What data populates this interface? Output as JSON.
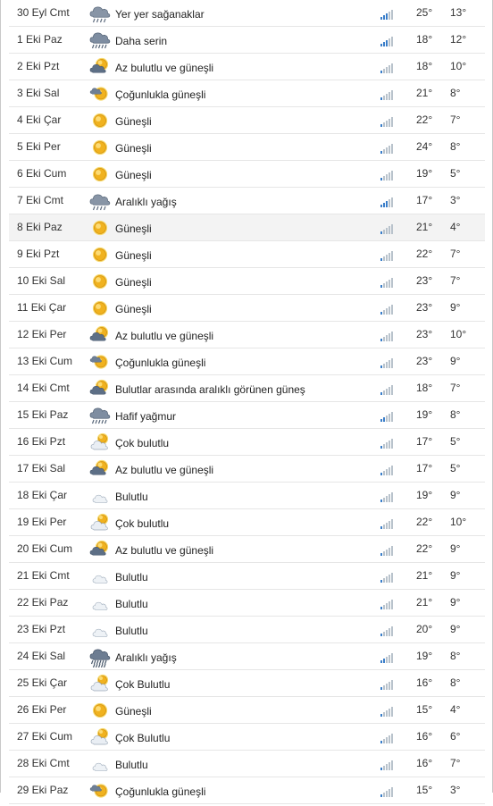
{
  "colors": {
    "row_border": "#e6e6e6",
    "highlight_row": "#f3f3f3",
    "signal_active": "#3a7ec9",
    "signal_inactive": "#b9c3cc"
  },
  "forecast": [
    {
      "day": "30 Eyl Cmt",
      "desc": "Yer yer sağanaklar",
      "icon": "showers-icon",
      "hi": "25°",
      "lo": "13°",
      "signal": 3,
      "highlight": false
    },
    {
      "day": "1 Eki Paz",
      "desc": "Daha serin",
      "icon": "rain-icon",
      "hi": "18°",
      "lo": "12°",
      "signal": 3,
      "highlight": false
    },
    {
      "day": "2 Eki Pzt",
      "desc": "Az bulutlu ve güneşli",
      "icon": "partly-sunny-icon",
      "hi": "18°",
      "lo": "10°",
      "signal": 1,
      "highlight": false
    },
    {
      "day": "3 Eki Sal",
      "desc": "Çoğunlukla güneşli",
      "icon": "mostly-sunny-icon",
      "hi": "21°",
      "lo": "8°",
      "signal": 1,
      "highlight": false
    },
    {
      "day": "4 Eki Çar",
      "desc": "Güneşli",
      "icon": "sun-icon",
      "hi": "22°",
      "lo": "7°",
      "signal": 1,
      "highlight": false
    },
    {
      "day": "5 Eki Per",
      "desc": "Güneşli",
      "icon": "sun-icon",
      "hi": "24°",
      "lo": "8°",
      "signal": 1,
      "highlight": false
    },
    {
      "day": "6 Eki Cum",
      "desc": "Güneşli",
      "icon": "sun-icon",
      "hi": "19°",
      "lo": "5°",
      "signal": 1,
      "highlight": false
    },
    {
      "day": "7 Eki Cmt",
      "desc": "Aralıklı yağış",
      "icon": "showers-icon",
      "hi": "17°",
      "lo": "3°",
      "signal": 3,
      "highlight": false
    },
    {
      "day": "8 Eki Paz",
      "desc": "Güneşli",
      "icon": "sun-icon",
      "hi": "21°",
      "lo": "4°",
      "signal": 1,
      "highlight": true
    },
    {
      "day": "9 Eki Pzt",
      "desc": "Güneşli",
      "icon": "sun-icon",
      "hi": "22°",
      "lo": "7°",
      "signal": 1,
      "highlight": false
    },
    {
      "day": "10 Eki Sal",
      "desc": "Güneşli",
      "icon": "sun-icon",
      "hi": "23°",
      "lo": "7°",
      "signal": 1,
      "highlight": false
    },
    {
      "day": "11 Eki Çar",
      "desc": "Güneşli",
      "icon": "sun-icon",
      "hi": "23°",
      "lo": "9°",
      "signal": 1,
      "highlight": false
    },
    {
      "day": "12 Eki Per",
      "desc": "Az bulutlu ve güneşli",
      "icon": "partly-sunny-icon",
      "hi": "23°",
      "lo": "10°",
      "signal": 1,
      "highlight": false
    },
    {
      "day": "13 Eki Cum",
      "desc": "Çoğunlukla güneşli",
      "icon": "mostly-sunny-icon",
      "hi": "23°",
      "lo": "9°",
      "signal": 1,
      "highlight": false
    },
    {
      "day": "14 Eki Cmt",
      "desc": "Bulutlar arasında aralıklı görünen güneş",
      "icon": "partly-sunny-icon",
      "hi": "18°",
      "lo": "7°",
      "signal": 1,
      "highlight": false
    },
    {
      "day": "15 Eki Paz",
      "desc": "Hafif yağmur",
      "icon": "rain-icon",
      "hi": "19°",
      "lo": "8°",
      "signal": 2,
      "highlight": false
    },
    {
      "day": "16 Eki Pzt",
      "desc": "Çok bulutlu",
      "icon": "mostly-cloudy-icon",
      "hi": "17°",
      "lo": "5°",
      "signal": 1,
      "highlight": false
    },
    {
      "day": "17 Eki Sal",
      "desc": "Az bulutlu ve güneşli",
      "icon": "partly-sunny-icon",
      "hi": "17°",
      "lo": "5°",
      "signal": 1,
      "highlight": false
    },
    {
      "day": "18 Eki Çar",
      "desc": "Bulutlu",
      "icon": "cloud-icon",
      "hi": "19°",
      "lo": "9°",
      "signal": 1,
      "highlight": false
    },
    {
      "day": "19 Eki Per",
      "desc": "Çok bulutlu",
      "icon": "mostly-cloudy-icon",
      "hi": "22°",
      "lo": "10°",
      "signal": 1,
      "highlight": false
    },
    {
      "day": "20 Eki Cum",
      "desc": "Az bulutlu ve güneşli",
      "icon": "partly-sunny-icon",
      "hi": "22°",
      "lo": "9°",
      "signal": 1,
      "highlight": false
    },
    {
      "day": "21 Eki Cmt",
      "desc": "Bulutlu",
      "icon": "cloud-icon",
      "hi": "21°",
      "lo": "9°",
      "signal": 1,
      "highlight": false
    },
    {
      "day": "22 Eki Paz",
      "desc": "Bulutlu",
      "icon": "cloud-icon",
      "hi": "21°",
      "lo": "9°",
      "signal": 1,
      "highlight": false
    },
    {
      "day": "23 Eki Pzt",
      "desc": "Bulutlu",
      "icon": "cloud-icon",
      "hi": "20°",
      "lo": "9°",
      "signal": 1,
      "highlight": false
    },
    {
      "day": "24 Eki Sal",
      "desc": "Aralıklı yağış",
      "icon": "heavy-rain-icon",
      "hi": "19°",
      "lo": "8°",
      "signal": 2,
      "highlight": false
    },
    {
      "day": "25 Eki Çar",
      "desc": "Çok Bulutlu",
      "icon": "mostly-cloudy-icon",
      "hi": "16°",
      "lo": "8°",
      "signal": 1,
      "highlight": false
    },
    {
      "day": "26 Eki Per",
      "desc": "Güneşli",
      "icon": "sun-icon",
      "hi": "15°",
      "lo": "4°",
      "signal": 1,
      "highlight": false
    },
    {
      "day": "27 Eki Cum",
      "desc": "Çok Bulutlu",
      "icon": "mostly-cloudy-icon",
      "hi": "16°",
      "lo": "6°",
      "signal": 1,
      "highlight": false
    },
    {
      "day": "28 Eki Cmt",
      "desc": "Bulutlu",
      "icon": "cloud-icon",
      "hi": "16°",
      "lo": "7°",
      "signal": 1,
      "highlight": false
    },
    {
      "day": "29 Eki Paz",
      "desc": "Çoğunlukla güneşli",
      "icon": "mostly-sunny-icon",
      "hi": "15°",
      "lo": "3°",
      "signal": 1,
      "highlight": false
    }
  ]
}
